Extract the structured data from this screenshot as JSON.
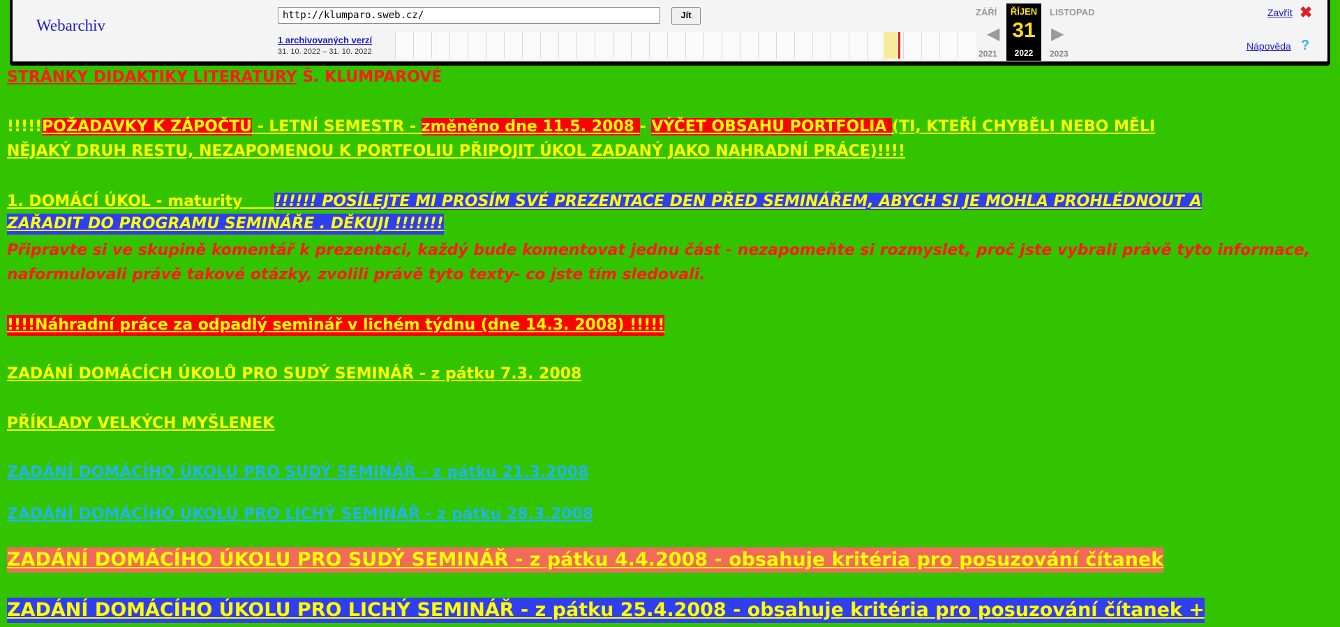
{
  "toolbar": {
    "logo": "Webarchiv",
    "url": "http://klumparo.sweb.cz/",
    "go_label": "Jít",
    "versions_link": "1 archivovaných verzí",
    "range": "31. 10. 2022 – 31. 10. 2022",
    "prev_month": "ZÁŘÍ",
    "current_month": "ŘÍJEN",
    "current_day": "31",
    "current_year": "2022",
    "next_month": "LISTOPAD",
    "prev_year": "2021",
    "next_year": "2023",
    "close_label": "Zavřít",
    "help_label": "Nápověda",
    "icons": {
      "prev": "chevron-left-icon",
      "next": "chevron-right-icon",
      "close": "close-icon",
      "help": "help-icon"
    }
  },
  "content": {
    "title_link": "STRÁNKY  DIDAKTIKY LITERATURY",
    "title_author": "Š. KLUMPAROVÉ",
    "req_prefix": "!!!!!",
    "req_link": "POŽADAVKY K ZÁPOČTU",
    "req_mid": " - LETNÍ SEMESTR - ",
    "req_changed": "změněno dne 11.5. 2008 ",
    "req_dash": " - ",
    "req_portfolio": "VÝČET OBSAHU PORTFOLIA ",
    "req_note_1": "(TI, KTEŘÍ CHYBĚLI NEBO MĚLI",
    "req_note_2": "NĚJAKÝ DRUH RESTU, NEZAPOMENOU K PORTFOLIU PŘIPOJIT ÚKOL ZADANÝ JAKO NAHRADNÍ PRÁCE)!!!!",
    "hw1_link": "1. DOMÁCÍ ÚKOL - maturity      ",
    "hw1_note_1": "!!!!!! POSÍLEJTE MI PROSÍM SVÉ PREZENTACE DEN PŘED SEMINÁŘEM, ABYCH SI JE MOHLA PROHLÉDNOUT A",
    "hw1_note_2": "ZAŘADIT DO PROGRAMU SEMINÁŘE . DĚKUJI !!!!!!!",
    "hw1_instr_1": "Připravte si ve skupině komentář k prezentaci, každý bude komentovat jednu část - nezapomeňte si rozmyslet, proč jste vybrali právě tyto informace,",
    "hw1_instr_2": "naformulovali právě takové otázky, zvolili právě tyto texty- co jste tím sledovali.",
    "replacement": "!!!!Náhradní práce za odpadlý seminář v lichém týdnu (dne 14.3. 2008) !!!!!",
    "hw_even_0703": "ZADÁNÍ DOMÁCÍCH ÚKOLŮ PRO SUDÝ SEMINÁŘ  - z pátku 7.3. 2008",
    "examples": "PŘÍKLADY VELKÝCH MYŠLENEK",
    "hw_even_2103": "ZADÁNÍ DOMÁCÍHO ÚKOLU PRO SUDÝ SEMINÁŘ  - z pátku 21.3.2008",
    "hw_odd_2803": "ZADÁNÍ DOMÁCÍHO ÚKOLU PRO LICHÝ SEMINÁŘ  - z pátku 28.3.2008",
    "hw_even_0404": "ZADÁNÍ DOMÁCÍHO ÚKOLU PRO SUDÝ SEMINÁŘ  - z pátku 4.4.2008 - obsahuje kritéria pro posuzování čítanek",
    "hw_odd_2504": "ZADÁNÍ DOMÁCÍHO ÚKOLU PRO LICHÝ SEMINÁŘ  - z pátku 25.4.2008 - obsahuje kritéria pro posuzování čítanek +"
  },
  "colors": {
    "page_bg": "#33c400",
    "yellow": "#ffff00",
    "red": "#ff0000",
    "blue": "#2f3ff0",
    "salmon": "#f26a5a",
    "cyan": "#22b4e8"
  }
}
